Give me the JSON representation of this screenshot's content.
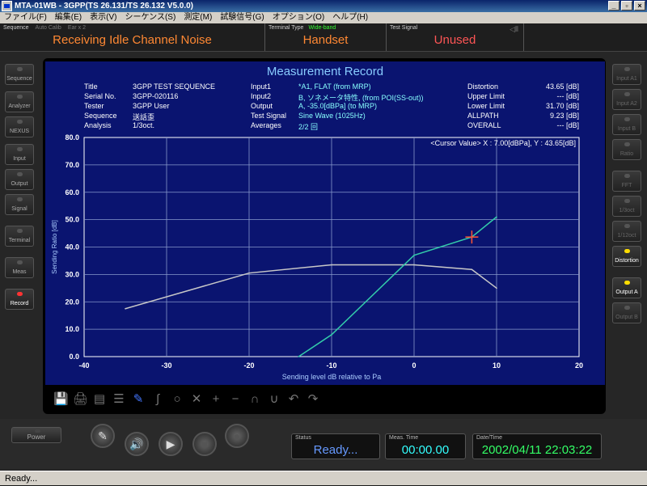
{
  "window": {
    "title": "MTA-01WB - 3GPP(TS 26.131/TS 26.132 V5.0.0)",
    "min": "_",
    "max": "▫",
    "close": "×"
  },
  "menu": [
    "ファイル(F)",
    "編集(E)",
    "表示(V)",
    "シーケンス(S)",
    "測定(M)",
    "試験信号(G)",
    "オプション(O)",
    "ヘルプ(H)"
  ],
  "topstatus": {
    "sequence_label": "Sequence",
    "auto_calib": "Auto Calib",
    "ear": "Ear x 2",
    "sequence_value": "Receiving Idle Channel Noise",
    "terminal_label": "Terminal Type",
    "terminal_band": "Wide-band",
    "terminal_value": "Handset",
    "signal_label": "Test Signal",
    "signal_value": "Unused"
  },
  "left_buttons": [
    "Sequence",
    "Analyzer",
    "NEXUS",
    "Input",
    "Output",
    "Signal",
    "Terminal",
    "Meas",
    "Record"
  ],
  "right_buttons": [
    "Input A1",
    "Input A2",
    "Input B",
    "Ratio",
    "FFT",
    "1/3oct",
    "1/12oct",
    "Distortion",
    "Output A",
    "Output B"
  ],
  "screen": {
    "title": "Measurement Record",
    "col1": [
      {
        "k": "Title",
        "v": "3GPP TEST SEQUENCE"
      },
      {
        "k": "Serial No.",
        "v": "3GPP-020116"
      },
      {
        "k": "Tester",
        "v": "3GPP User"
      },
      {
        "k": "Sequence",
        "v": "送話歪"
      },
      {
        "k": "Analysis",
        "v": "1/3oct."
      }
    ],
    "col2": [
      {
        "k": "Input1",
        "v": "*A1, FLAT (from MRP)"
      },
      {
        "k": "Input2",
        "v": "B, ソネメータ特性, (from POI(SS-out))"
      },
      {
        "k": "Output",
        "v": "A, -35.0[dBPa] (to MRP)"
      },
      {
        "k": "Test Signal",
        "v": "Sine Wave (1025Hz)"
      },
      {
        "k": "Averages",
        "v": "2/2 回"
      }
    ],
    "col3": [
      {
        "k": "Distortion",
        "v": "43.65 [dB]"
      },
      {
        "k": "Upper Limit",
        "v": "--- [dB]"
      },
      {
        "k": "Lower Limit",
        "v": "31.70 [dB]"
      },
      {
        "k": "ALLPATH",
        "v": "9.23 [dB]"
      },
      {
        "k": "OVERALL",
        "v": "--- [dB]"
      }
    ],
    "cursor": "<Cursor Value> X : 7.00[dBPa], Y : 43.65[dB]"
  },
  "chart_data": {
    "type": "line",
    "xlabel": "Sending level dB relative to Pa",
    "ylabel": "Sending Ratio [dB]",
    "xlim": [
      -40,
      20
    ],
    "ylim": [
      0,
      80
    ],
    "xticks": [
      "-40",
      "-30",
      "-20",
      "-10",
      "0",
      "10",
      "20"
    ],
    "yticks": [
      "0.0",
      "10.0",
      "20.0",
      "30.0",
      "40.0",
      "50.0",
      "60.0",
      "70.0",
      "80.0"
    ],
    "series": [
      {
        "color": "#c8c8c8",
        "x": [
          -35,
          -20,
          -10,
          0,
          7,
          10
        ],
        "y": [
          17.5,
          30.5,
          33.5,
          33.5,
          31.8,
          25
        ]
      },
      {
        "color": "#33ccaa",
        "x": [
          -14,
          -10,
          0,
          7,
          10
        ],
        "y": [
          0,
          8,
          37,
          43.65,
          51
        ]
      }
    ],
    "cursor": {
      "x": 7,
      "y": 43.65,
      "color": "#ff5533"
    }
  },
  "tools": [
    "💾",
    "🖨",
    "▤",
    "☰",
    "✎",
    "∫",
    "○",
    "✕",
    "+",
    "−",
    "∩",
    "∪",
    "↶",
    "↷"
  ],
  "power": "Power",
  "transport": {
    "pen": "✎",
    "speaker": "🔊",
    "play": "▶",
    "stop": "■",
    "record": "●"
  },
  "readouts": {
    "status_label": "Status",
    "status_value": "Ready...",
    "time_label": "Meas. Time",
    "time_value": "00:00.00",
    "date_label": "Date/Time",
    "date_value": "2002/04/11 22:03:22"
  },
  "statusbar": "Ready...",
  "colors": {
    "screen_bg": "#0a1470",
    "accent_orange": "#ff8833",
    "readout_cyan": "#33ffff",
    "readout_blue": "#6699ff",
    "readout_green": "#33ff66"
  }
}
